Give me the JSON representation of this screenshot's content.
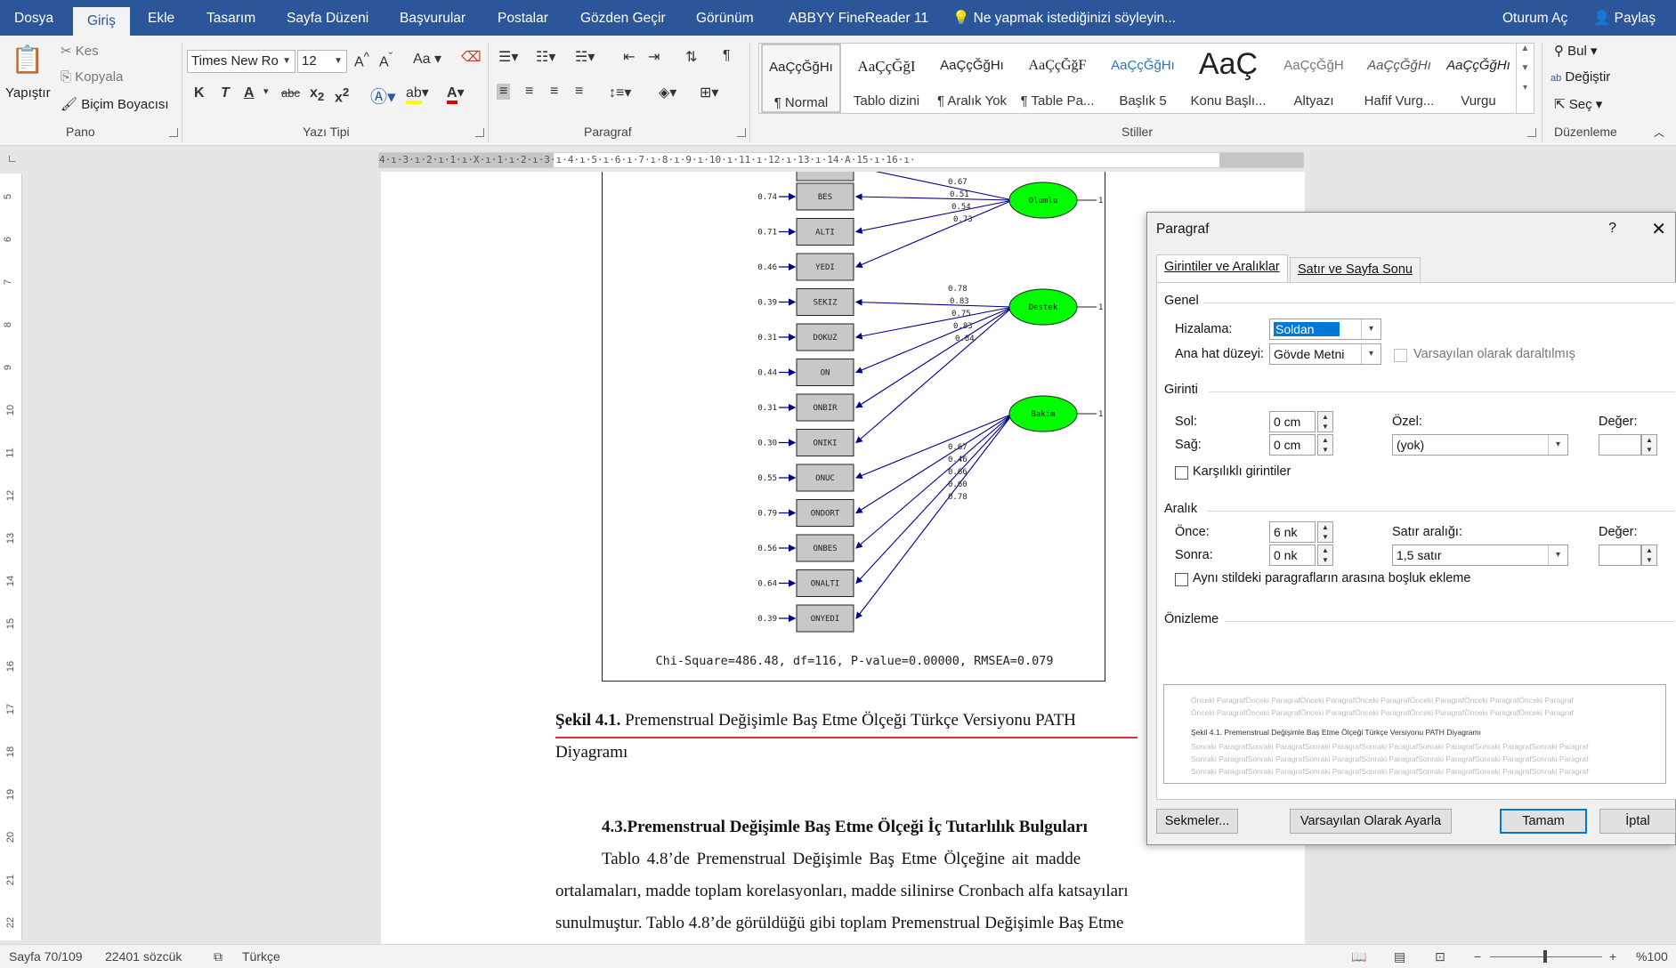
{
  "tabs": [
    "Dosya",
    "Giriş",
    "Ekle",
    "Tasarım",
    "Sayfa Düzeni",
    "Başvurular",
    "Postalar",
    "Gözden Geçir",
    "Görünüm",
    "ABBYY FineReader 11"
  ],
  "tell_me": "Ne yapmak istediğinizi söyleyin...",
  "sign_in": "Oturum Aç",
  "share": "Paylaş",
  "ribbon": {
    "clipboard": {
      "paste": "Yapıştır",
      "cut": "Kes",
      "copy": "Kopyala",
      "format_painter": "Biçim Boyacısı",
      "label": "Pano"
    },
    "font": {
      "name": "Times New Ro",
      "size": "12",
      "change_case": "Aa",
      "label": "Yazı Tipi"
    },
    "paragraph": {
      "label": "Paragraf"
    },
    "styles": {
      "label": "Stiller",
      "items": [
        {
          "preview": "AaÇçĞğHı",
          "name": "¶ Normal"
        },
        {
          "preview": "AaÇçĞğI",
          "name": "Tablo dizini"
        },
        {
          "preview": "AaÇçĞğHı",
          "name": "¶ Aralık Yok"
        },
        {
          "preview": "AaÇçĞğF",
          "name": "¶ Table Pa..."
        },
        {
          "preview": "AaÇçĞğHı",
          "name": "Başlık 5"
        },
        {
          "preview": "AaÇ",
          "name": "Konu Başlı..."
        },
        {
          "preview": "AaÇçĞğH",
          "name": "Altyazı"
        },
        {
          "preview": "AaÇçĞğHı",
          "name": "Hafif Vurg..."
        },
        {
          "preview": "AaÇçĞğHı",
          "name": "Vurgu"
        }
      ]
    },
    "editing": {
      "find": "Bul",
      "replace": "Değiştir",
      "select": "Seç",
      "label": "Düzenleme"
    }
  },
  "ruler_text": "4·ı·3·ı·2·ı·1·ı·X·ı·1·ı·2·ı·3·ı·4·ı·5·ı·6·ı·7·ı·8·ı·9·ı·10·ı·11·ı·12·ı·13·ı·14·A·15·ı·16·ı·",
  "vruler": [
    "5",
    "6",
    "7",
    "8",
    "9",
    "10",
    "11",
    "12",
    "13",
    "14",
    "15",
    "16",
    "17",
    "18",
    "19",
    "20",
    "21",
    "22"
  ],
  "diagram": {
    "boxes": [
      {
        "name": "BES",
        "err": "0.74"
      },
      {
        "name": "ALTI",
        "err": "0.71"
      },
      {
        "name": "YEDI",
        "err": "0.46"
      },
      {
        "name": "SEKIZ",
        "err": "0.39"
      },
      {
        "name": "DOKUZ",
        "err": "0.31"
      },
      {
        "name": "ON",
        "err": "0.44"
      },
      {
        "name": "ONBIR",
        "err": "0.31"
      },
      {
        "name": "ONIKI",
        "err": "0.30"
      },
      {
        "name": "ONUC",
        "err": "0.55"
      },
      {
        "name": "ONDORT",
        "err": "0.79"
      },
      {
        "name": "ONBES",
        "err": "0.56"
      },
      {
        "name": "ONALTI",
        "err": "0.64"
      },
      {
        "name": "ONYEDI",
        "err": "0.39"
      }
    ],
    "factors": [
      {
        "name": "Olumlu",
        "loadings": [
          "0.67",
          "0.51",
          "0.54",
          "0.73"
        ]
      },
      {
        "name": "Destek",
        "loadings": [
          "0.78",
          "0.83",
          "0.75",
          "0.83",
          "0.84"
        ]
      },
      {
        "name": "Bakim",
        "loadings": [
          "0.67",
          "0.46",
          "0.66",
          "0.60",
          "0.78"
        ]
      }
    ],
    "factor_variance": "1",
    "fit": "Chi-Square=486.48, df=116, P-value=0.00000, RMSEA=0.079"
  },
  "doc": {
    "caption_bold": "Şekil 4.1.",
    "caption_text": " Premenstrual Değişimle Baş Etme Ölçeği Türkçe Versiyonu PATH",
    "caption_line2": "Diyagramı",
    "heading": "4.3.Premenstrual Değişimle Baş Etme Ölçeği İç Tutarlılık Bulguları",
    "lines": [
      "Tablo  4.8’de  Premenstrual  Değişimle  Baş  Etme  Ölçeğine  ait  madde",
      "ortalamaları, madde toplam korelasyonları, madde silinirse Cronbach alfa katsayıları",
      "sunulmuştur. Tablo 4.8’de görüldüğü gibi toplam Premenstrual Değişimle Baş Etme"
    ]
  },
  "status": {
    "page": "Sayfa 70/109",
    "words": "22401 sözcük",
    "lang": "Türkçe",
    "zoom": "%100"
  },
  "dialog": {
    "title": "Paragraf",
    "help": "?",
    "tabs": [
      "Girintiler ve Aralıklar",
      "Satır ve Sayfa Sonu"
    ],
    "general": "Genel",
    "alignment_label": "Hizalama:",
    "alignment_value": "Soldan",
    "outline_label": "Ana hat düzeyi:",
    "outline_value": "Gövde Metni",
    "collapsed_label": "Varsayılan olarak daraltılmış",
    "indent": "Girinti",
    "left_label": "Sol:",
    "left_value": "0 cm",
    "right_label": "Sağ:",
    "right_value": "0 cm",
    "special_label": "Özel:",
    "special_value": "(yok)",
    "by_label": "Değer:",
    "mirror_label": "Karşılıklı girintiler",
    "spacing": "Aralık",
    "before_label": "Önce:",
    "before_value": "6 nk",
    "after_label": "Sonra:",
    "after_value": "0 nk",
    "line_spacing_label": "Satır aralığı:",
    "line_spacing_value": "1,5 satır",
    "at_label": "Değer:",
    "dont_add_space_label": "Aynı stildeki paragrafların arasına boşluk ekleme",
    "preview": "Önizleme",
    "preview_prev": "Önceki ParagrafÖnceki ParagrafÖnceki ParagrafÖnceki ParagrafÖnceki ParagrafÖnceki ParagrafÖnceki Paragraf",
    "preview_prev2": "Önceki ParagrafÖnceki ParagrafÖnceki ParagrafÖnceki ParagrafÖnceki ParagrafÖnceki ParagrafÖnceki Paragraf",
    "preview_main": "Şekil 4.1. Premenstrual Değişimle Baş Etme Ölçeği Türkçe Versiyonu PATH Diyagramı",
    "preview_next": "Sonraki ParagrafSonraki ParagrafSonraki ParagrafSonraki ParagrafSonraki ParagrafSonraki ParagrafSonraki Paragraf",
    "preview_next2": "Sonraki ParagrafSonraki ParagrafSonraki ParagrafSonraki ParagrafSonraki ParagrafSonraki ParagrafSonraki Paragraf",
    "preview_next3": "Sonraki ParagrafSonraki ParagrafSonraki ParagrafSonraki ParagrafSonraki ParagrafSonraki ParagrafSonraki Paragraf",
    "tabs_button": "Sekmeler...",
    "default_button": "Varsayılan Olarak Ayarla",
    "ok_button": "Tamam",
    "cancel_button": "İptal"
  },
  "colors": {
    "accent": "#2b579a",
    "factor_fill": "#00ff00",
    "arrow": "#00008b",
    "selection": "#0078d7"
  }
}
